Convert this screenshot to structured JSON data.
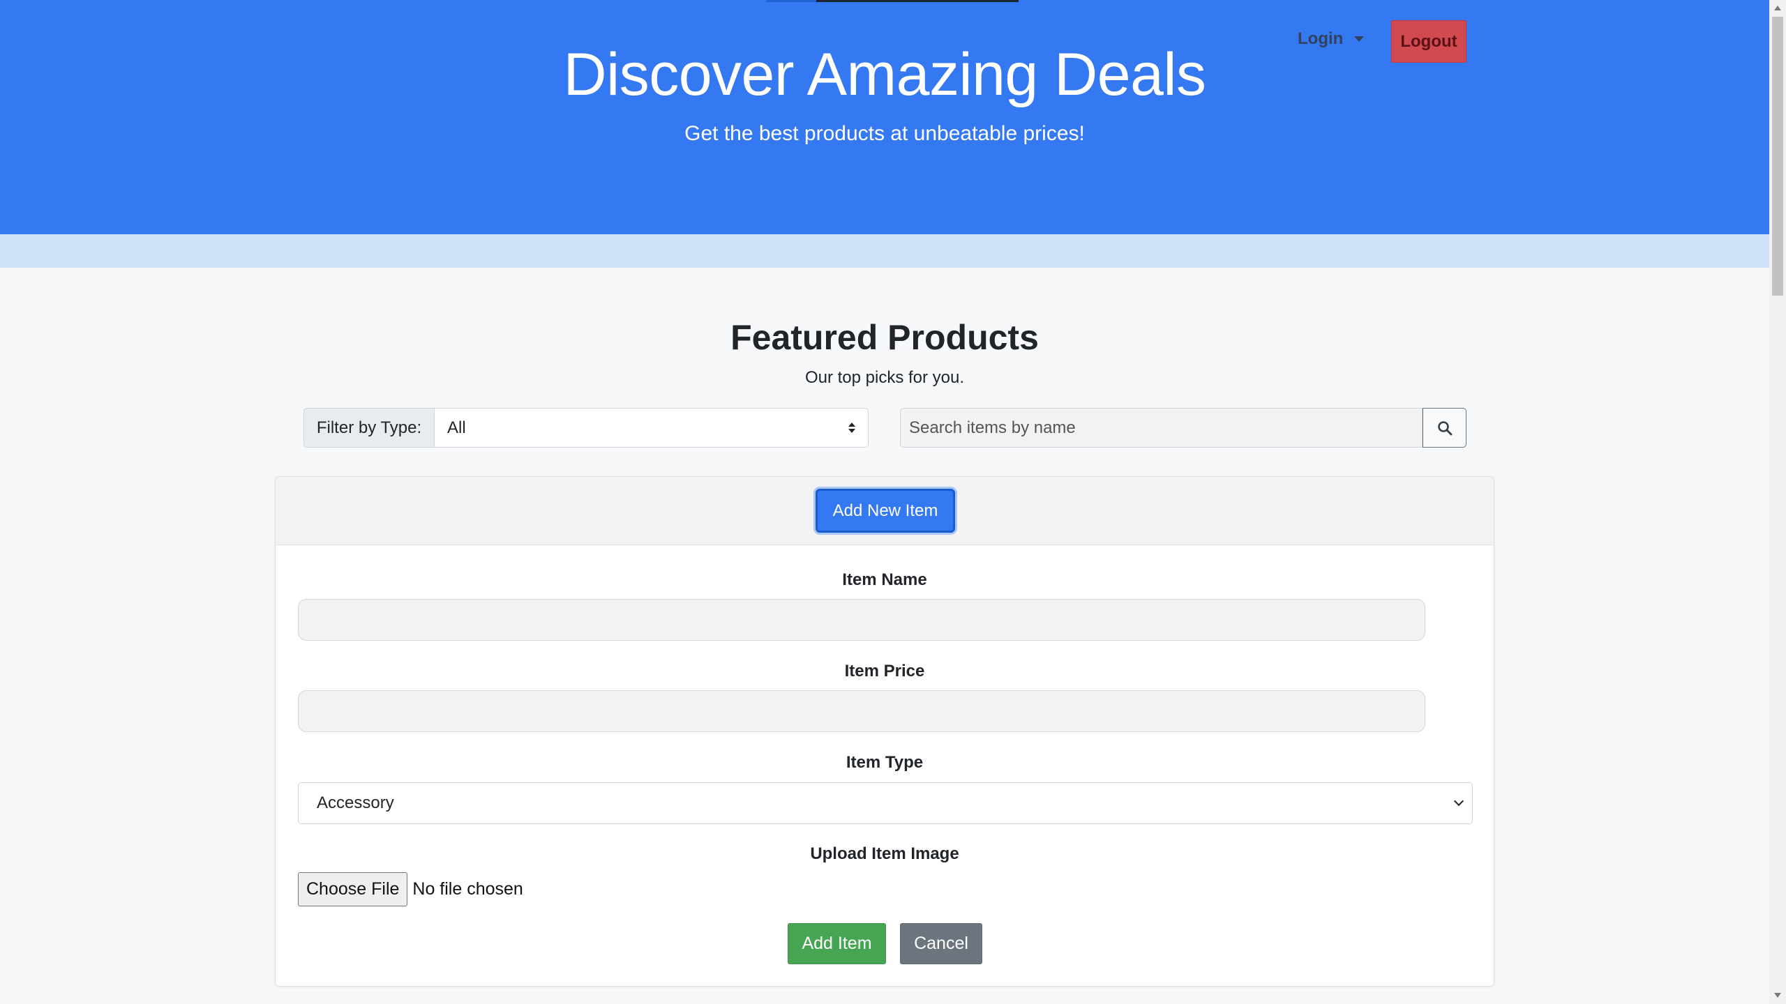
{
  "header": {
    "title": "Discover Amazing Deals",
    "subtitle": "Get the best products at unbeatable prices!",
    "login_label": "Login",
    "logout_label": "Logout"
  },
  "featured": {
    "title": "Featured Products",
    "subtitle": "Our top picks for you."
  },
  "filter": {
    "label": "Filter by Type:",
    "selected": "All"
  },
  "search": {
    "placeholder": "Search items by name",
    "icon": "search-icon"
  },
  "add_form": {
    "toggle_label": "Add New Item",
    "name_label": "Item Name",
    "name_value": "",
    "price_label": "Item Price",
    "price_value": "",
    "type_label": "Item Type",
    "type_selected": "Accessory",
    "image_label": "Upload Item Image",
    "choose_file_label": "Choose File",
    "file_status": "No file chosen",
    "submit_label": "Add Item",
    "cancel_label": "Cancel"
  },
  "colors": {
    "primary": "#3479f2",
    "danger": "#d04a4f",
    "success": "#46a552",
    "secondary": "#6c757d",
    "band": "#cfe2fa"
  }
}
